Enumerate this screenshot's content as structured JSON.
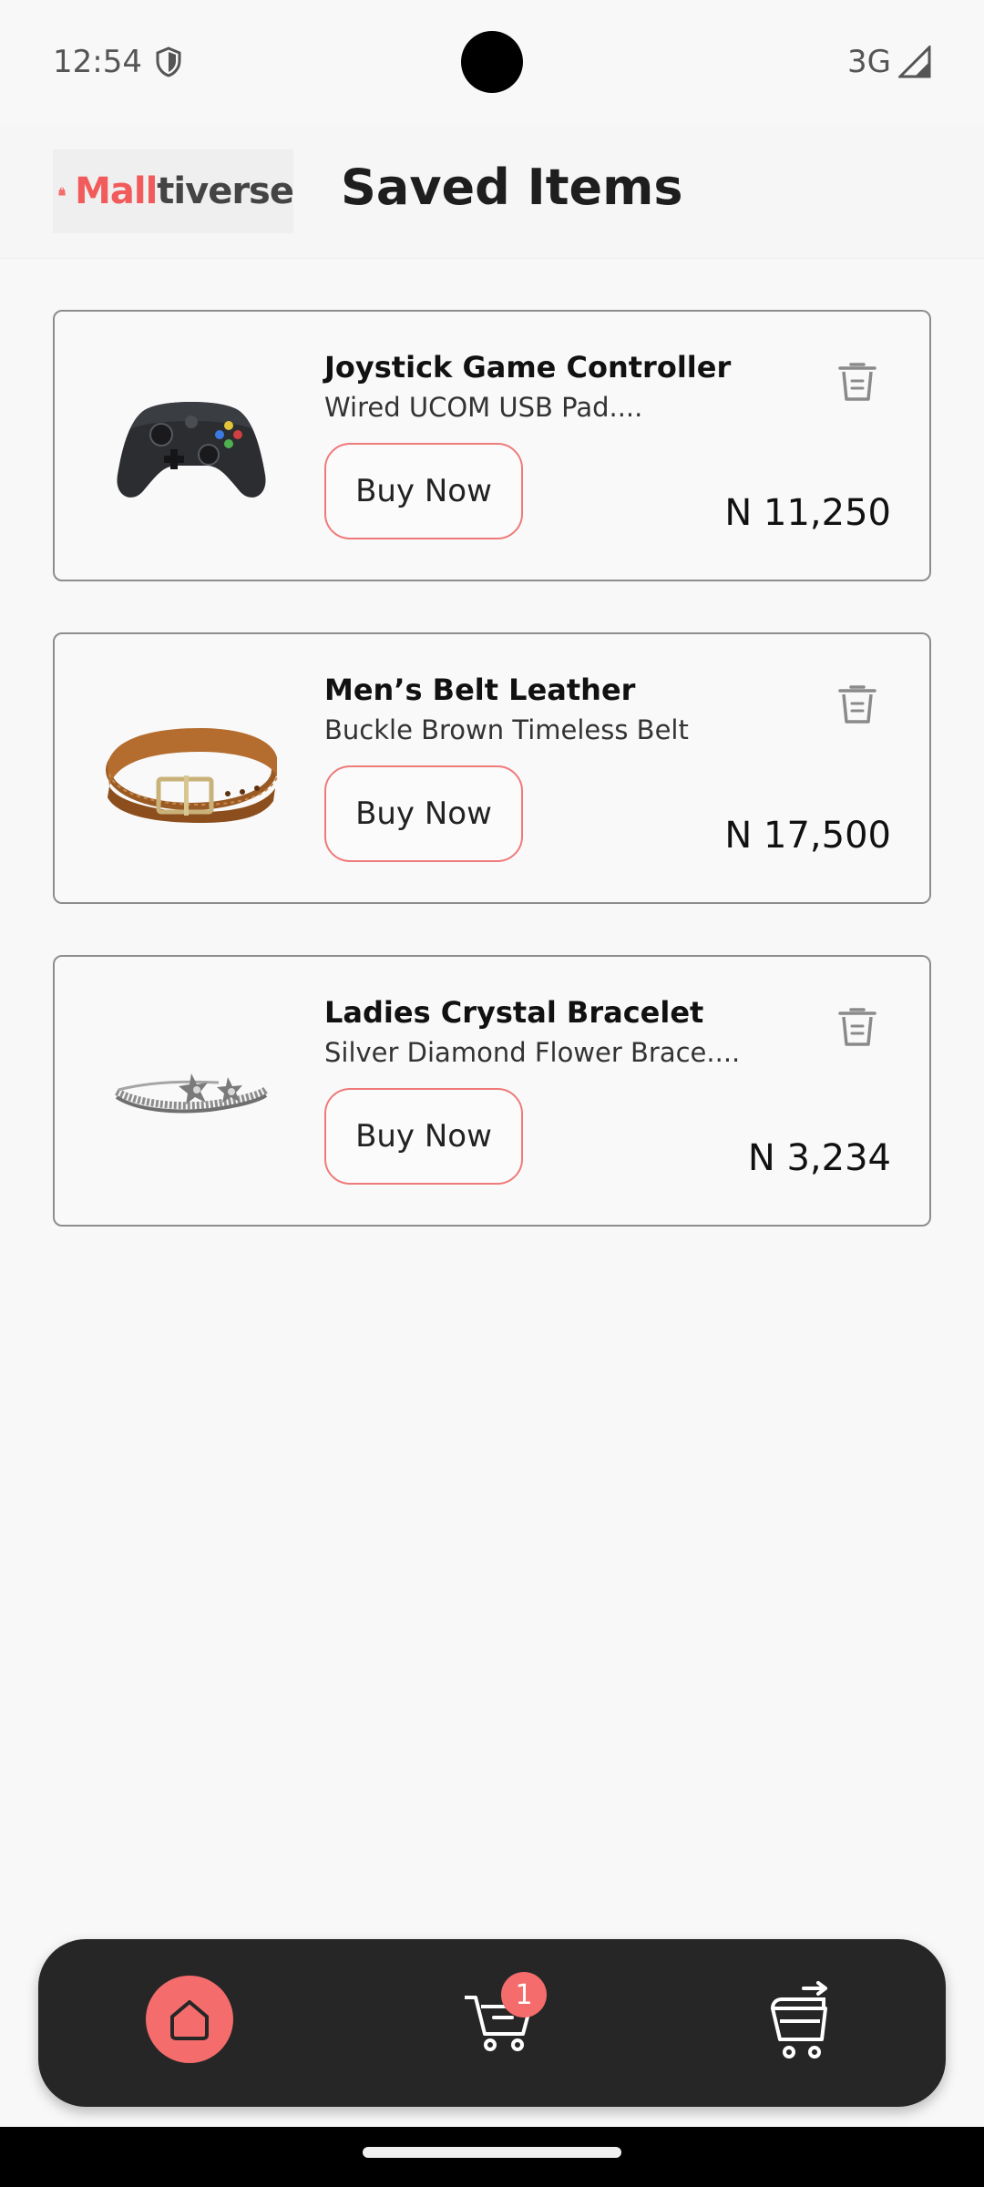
{
  "status_bar": {
    "time": "12:54",
    "network": "3G"
  },
  "header": {
    "logo_mall": "Mall",
    "logo_rest": "tiverse",
    "title": "Saved Items"
  },
  "items": [
    {
      "title": "Joystick Game Controller",
      "subtitle": "Wired UCOM USB Pad....",
      "button": "Buy Now",
      "price": "N 11,250"
    },
    {
      "title": "Men’s Belt Leather",
      "subtitle": "Buckle Brown Timeless Belt",
      "button": "Buy Now",
      "price": "N 17,500"
    },
    {
      "title": "Ladies Crystal Bracelet",
      "subtitle": "Silver Diamond Flower Brace....",
      "button": "Buy Now",
      "price": "N 3,234"
    }
  ],
  "nav": {
    "cart_count": "1"
  },
  "colors": {
    "accent": "#f46c6c",
    "nav_bg": "#262626"
  }
}
